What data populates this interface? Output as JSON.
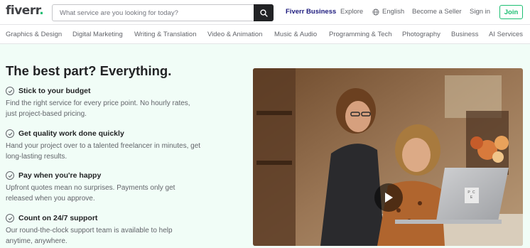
{
  "header": {
    "logo_text": "fiverr",
    "logo_dot": ".",
    "search_placeholder": "What service are you looking for today?",
    "nav": {
      "business": "Fiverr Business",
      "explore": "Explore",
      "language": "English",
      "seller": "Become a Seller",
      "signin": "Sign in",
      "join": "Join"
    }
  },
  "categories": [
    "Graphics & Design",
    "Digital Marketing",
    "Writing & Translation",
    "Video & Animation",
    "Music & Audio",
    "Programming & Tech",
    "Photography",
    "Business",
    "AI Services"
  ],
  "main": {
    "headline": "The best part? Everything.",
    "features": [
      {
        "title": "Stick to your budget",
        "desc": "Find the right service for every price point. No hourly rates, just project-based pricing."
      },
      {
        "title": "Get quality work done quickly",
        "desc": "Hand your project over to a talented freelancer in minutes, get long-lasting results."
      },
      {
        "title": "Pay when you're happy",
        "desc": "Upfront quotes mean no surprises. Payments only get released when you approve."
      },
      {
        "title": "Count on 24/7 support",
        "desc": "Our round-the-clock support team is available to help anytime, anywhere."
      }
    ],
    "laptop_sticker": "P C E"
  },
  "colors": {
    "brand_green": "#1dbf73",
    "business_blue": "#1d1b7e",
    "main_bg": "#f1fdf7",
    "text_dark": "#222325",
    "text_muted": "#62646a"
  },
  "icons": {
    "search": "search-icon",
    "globe": "globe-icon",
    "check": "check-circle-icon",
    "play": "play-icon"
  }
}
